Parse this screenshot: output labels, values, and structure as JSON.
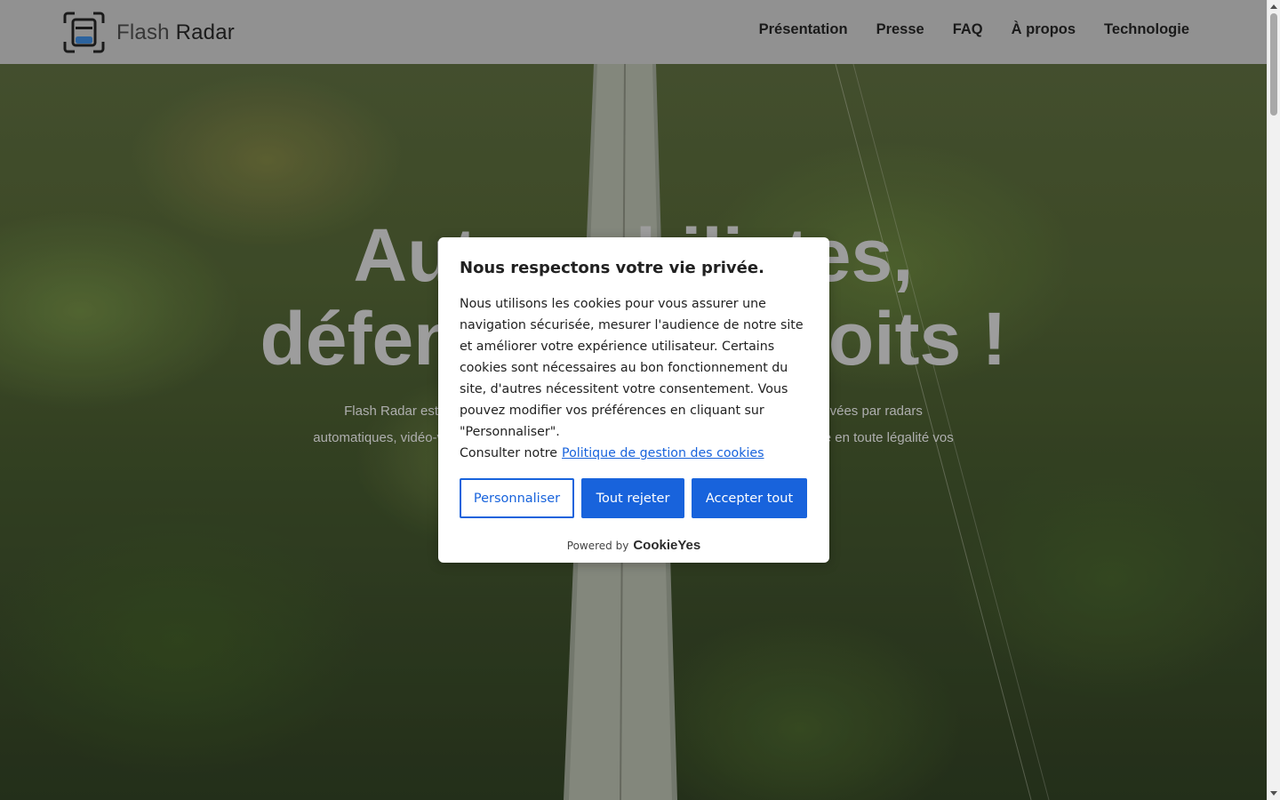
{
  "site": {
    "logo_text_light": "Flash",
    "logo_text_bold": "Radar"
  },
  "nav": {
    "items": [
      {
        "label": "Présentation"
      },
      {
        "label": "Presse"
      },
      {
        "label": "FAQ"
      },
      {
        "label": "À propos"
      },
      {
        "label": "Technologie"
      }
    ]
  },
  "hero": {
    "title_line1": "Automobilistes,",
    "title_line2": "défendez vos droits !",
    "subtitle": "Flash Radar est l'application qui vous aide à contester les infractions routières relevées par radars automatiques, vidéo-verbalisation et autres dispositifs, pour vous permettre de défendre en toute légalité vos"
  },
  "cookie": {
    "title": "Nous respectons votre vie privée.",
    "body": "Nous utilisons les cookies pour vous assurer une navigation sécurisée, mesurer l'audience de notre site et améliorer votre expérience utilisateur. Certains cookies sont nécessaires au bon fonctionnement du site, d'autres nécessitent votre consentement. Vous pouvez modifier vos préférences en cliquant sur \"Personnaliser\".",
    "policy_prefix": "Consulter notre",
    "policy_link": "Politique de gestion des cookies",
    "btn_customize": "Personnaliser",
    "btn_reject": "Tout rejeter",
    "btn_accept": "Accepter tout",
    "powered_by": "Powered by",
    "brand": "CookieYes"
  },
  "colors": {
    "accent": "#1863dc",
    "header_bg": "#9b9b9b"
  }
}
